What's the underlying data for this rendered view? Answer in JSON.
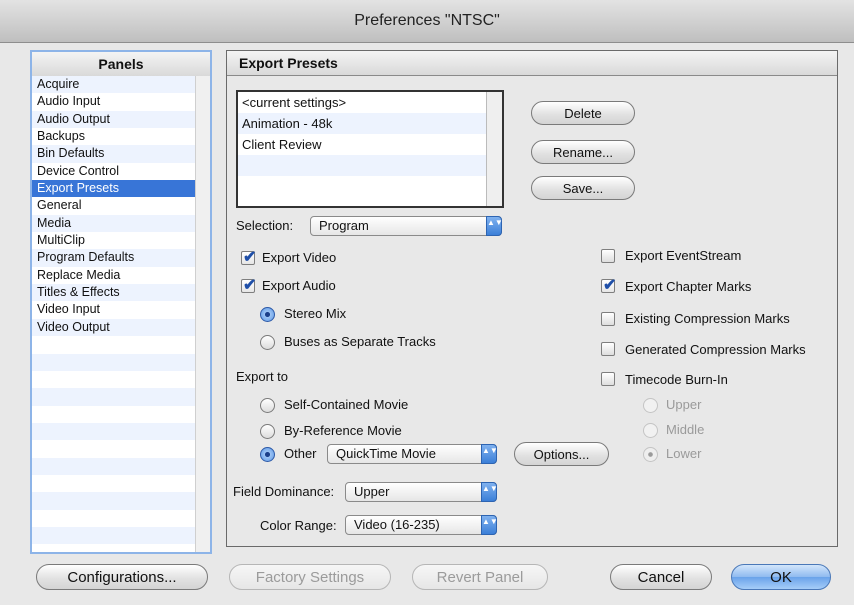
{
  "window": {
    "title": "Preferences \"NTSC\""
  },
  "panels": {
    "header": "Panels",
    "items": [
      "Acquire",
      "Audio Input",
      "Audio Output",
      "Backups",
      "Bin Defaults",
      "Device Control",
      "Export Presets",
      "General",
      "Media",
      "MultiClip",
      "Program Defaults",
      "Replace Media",
      "Titles & Effects",
      "Video Input",
      "Video Output"
    ],
    "selected": "Export Presets"
  },
  "export_presets": {
    "header": "Export Presets",
    "presets": [
      "<current settings>",
      "Animation - 48k",
      "Client Review"
    ],
    "buttons": {
      "delete": "Delete",
      "rename": "Rename...",
      "save": "Save..."
    },
    "selection": {
      "label": "Selection:",
      "value": "Program"
    },
    "export_video": {
      "label": "Export Video",
      "checked": true
    },
    "export_audio": {
      "label": "Export Audio",
      "checked": true
    },
    "stereo_mix": {
      "label": "Stereo Mix",
      "selected": true
    },
    "buses_separate": {
      "label": "Buses as Separate Tracks",
      "selected": false
    },
    "export_to": {
      "label": "Export to",
      "self_contained": {
        "label": "Self-Contained Movie",
        "selected": false
      },
      "by_reference": {
        "label": "By-Reference Movie",
        "selected": false
      },
      "other": {
        "label": "Other",
        "selected": true,
        "value": "QuickTime Movie"
      },
      "options_label": "Options..."
    },
    "field_dominance": {
      "label": "Field Dominance:",
      "value": "Upper"
    },
    "color_range": {
      "label": "Color Range:",
      "value": "Video (16-235)"
    },
    "export_eventstream": {
      "label": "Export EventStream",
      "checked": false
    },
    "export_chapter_marks": {
      "label": "Export Chapter Marks",
      "checked": true
    },
    "existing_compression_marks": {
      "label": "Existing Compression  Marks",
      "checked": false
    },
    "generated_compression_marks": {
      "label": "Generated Compression Marks",
      "checked": false
    },
    "timecode_burn_in": {
      "label": "Timecode Burn-In",
      "checked": false,
      "upper": "Upper",
      "middle": "Middle",
      "lower": "Lower",
      "selected": "Lower"
    }
  },
  "footer": {
    "configurations": "Configurations...",
    "factory_settings": "Factory Settings",
    "revert_panel": "Revert Panel",
    "cancel": "Cancel",
    "ok": "OK"
  },
  "checkmark_glyph": "✔",
  "popup_arrows_glyph": "▲▼"
}
